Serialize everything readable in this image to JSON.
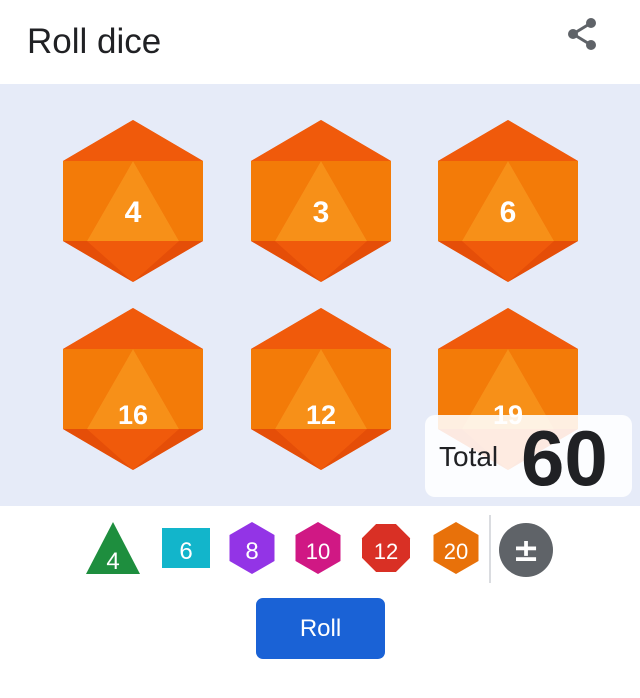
{
  "header": {
    "title": "Roll dice",
    "share_icon": "share-icon"
  },
  "dice": [
    {
      "value": "4"
    },
    {
      "value": "3"
    },
    {
      "value": "6"
    },
    {
      "value": "16"
    },
    {
      "value": "12"
    },
    {
      "value": "19"
    }
  ],
  "total": {
    "label": "Total",
    "value": "60"
  },
  "die_types": [
    {
      "label": "4",
      "shape": "triangle",
      "color": "#1e8e3e"
    },
    {
      "label": "6",
      "shape": "square",
      "color": "#12b5cb"
    },
    {
      "label": "8",
      "shape": "hexagon",
      "color": "#9334e6"
    },
    {
      "label": "10",
      "shape": "hexagon",
      "color": "#d01884"
    },
    {
      "label": "12",
      "shape": "octagon",
      "color": "#d93025"
    },
    {
      "label": "20",
      "shape": "hexagon",
      "color": "#e8710a"
    }
  ],
  "modifier_button": {
    "label": "±",
    "color": "#5f6368"
  },
  "roll_button": {
    "label": "Roll",
    "color": "#1a62d6"
  },
  "colors": {
    "die_main": "#f37b08",
    "die_dark": "#f05a0b",
    "die_light": "#f79018",
    "dice_bg": "#e6ebf8"
  }
}
